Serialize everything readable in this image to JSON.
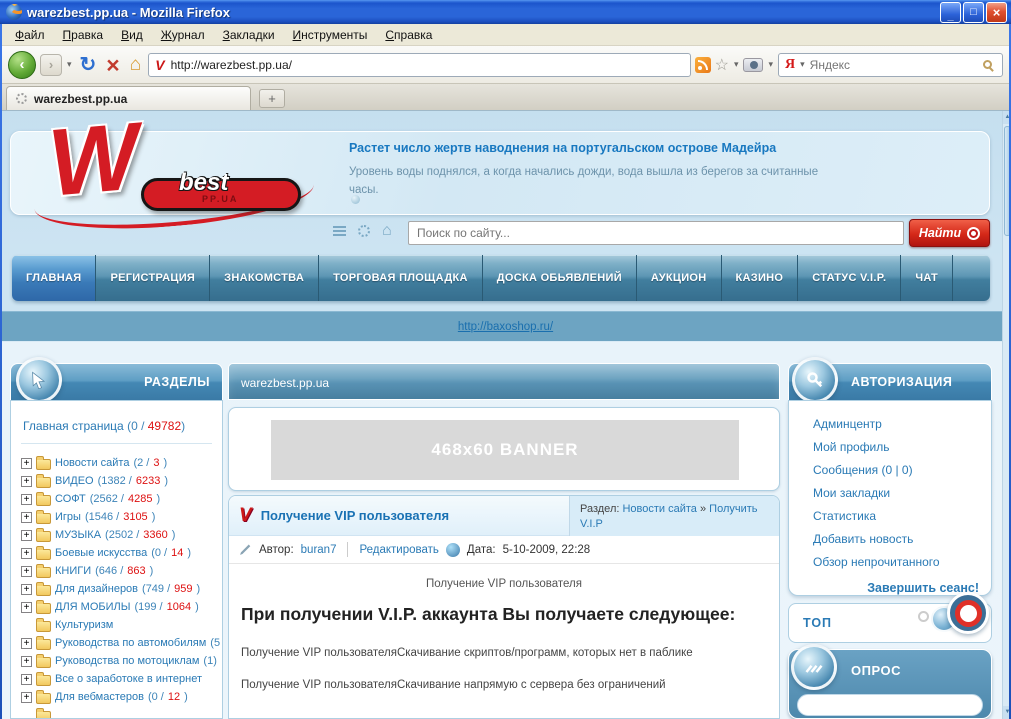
{
  "window": {
    "title": "warezbest.pp.ua - Mozilla Firefox",
    "menu_items": [
      "Файл",
      "Правка",
      "Вид",
      "Журнал",
      "Закладки",
      "Инструменты",
      "Справка"
    ],
    "url": "http://warezbest.pp.ua/",
    "yandex_placeholder": "Яндекс",
    "tab_title": "warezbest.pp.ua",
    "new_tab_label": "+"
  },
  "site_header": {
    "logo": {
      "letter": "W",
      "best": "best",
      "domain": "PP.UA"
    },
    "news_title": "Растет число жертв наводнения на португальском острове Мадейра",
    "news_body": "Уровень воды поднялся, а когда начались дожди, вода вышла из берегов за считанные часы."
  },
  "search": {
    "placeholder": "Поиск по сайту...",
    "button_label": "Найти"
  },
  "nav": {
    "items": [
      {
        "label": "ГЛАВНАЯ",
        "active": true
      },
      {
        "label": "РЕГИСТРАЦИЯ",
        "active": false
      },
      {
        "label": "ЗНАКОМСТВА",
        "active": false
      },
      {
        "label": "ТОРГОВАЯ ПЛОЩАДКА",
        "active": false
      },
      {
        "label": "ДОСКА ОБЬЯВЛЕНИЙ",
        "active": false
      },
      {
        "label": "АУКЦИОН",
        "active": false
      },
      {
        "label": "КАЗИНО",
        "active": false
      },
      {
        "label": "СТАТУС V.I.P.",
        "active": false
      },
      {
        "label": "ЧАТ",
        "active": false
      }
    ]
  },
  "banner_strip": {
    "link": "http://baxoshop.ru/"
  },
  "sections_panel": {
    "title": "РАЗДЕЛЫ",
    "home": {
      "label": "Главная страница",
      "count_open": " (0 / ",
      "count_red": "49782",
      "count_close": ")"
    },
    "items": [
      {
        "plus": true,
        "label": "Новости сайта",
        "c1": "(2 / ",
        "c2": "3",
        "c3": ")"
      },
      {
        "plus": true,
        "label": "ВИДЕО",
        "c1": "(1382 / ",
        "c2": "6233",
        "c3": ")"
      },
      {
        "plus": true,
        "label": "СОФТ",
        "c1": "(2562 / ",
        "c2": "4285",
        "c3": ")"
      },
      {
        "plus": true,
        "label": "Игры",
        "c1": "(1546 / ",
        "c2": "3105",
        "c3": ")"
      },
      {
        "plus": true,
        "label": "МУЗЫКА",
        "c1": "(2502 / ",
        "c2": "3360",
        "c3": ")"
      },
      {
        "plus": true,
        "label": "Боевые искусства",
        "c1": "(0 / ",
        "c2": "14",
        "c3": ")"
      },
      {
        "plus": true,
        "label": "КНИГИ",
        "c1": "(646 / ",
        "c2": "863",
        "c3": ")"
      },
      {
        "plus": true,
        "label": "Для дизайнеров",
        "c1": "(749 / ",
        "c2": "959",
        "c3": ")"
      },
      {
        "plus": true,
        "label": "ДЛЯ МОБИЛЫ",
        "c1": "(199 / ",
        "c2": "1064",
        "c3": ")"
      },
      {
        "plus": false,
        "label": "Культуризм",
        "c1": "",
        "c2": "",
        "c3": ""
      },
      {
        "plus": true,
        "label": "Руководства по автомобилям",
        "c1": "(5",
        "c2": "",
        "c3": ""
      },
      {
        "plus": true,
        "label": "Руководства по мотоциклам",
        "c1": "(1)",
        "c2": "",
        "c3": ""
      },
      {
        "plus": true,
        "label": "Все о заработоке в интернет",
        "c1": "",
        "c2": "",
        "c3": ""
      },
      {
        "plus": true,
        "label": "Для вебмастеров",
        "c1": "(0 / ",
        "c2": "12",
        "c3": ")"
      },
      {
        "plus": false,
        "label": "",
        "c1": "",
        "c2": "",
        "c3": ""
      }
    ]
  },
  "main": {
    "bar_title": "warezbest.pp.ua",
    "banner_text": "468x60 BANNER",
    "article": {
      "title": "Получение VIP пользователя",
      "breadcrumb_label": "Раздел:",
      "breadcrumb_link1": "Новости сайта",
      "breadcrumb_sep": "»",
      "breadcrumb_link2": "Получить V.I.P",
      "author_label": "Автор:",
      "author": "buran7",
      "edit_link": "Редактировать",
      "date_label": "Дата:",
      "date": "5-10-2009, 22:28",
      "line1": "Получение VIP пользователя",
      "heading": "При получении V.I.P. аккаунта Вы получаете следующее:",
      "para1": "Получение VIP пользователяСкачивание скриптов/программ, которых нет в паблике",
      "para2": "Получение VIP пользователяСкачивание напрямую с сервера без ограничений"
    }
  },
  "auth_panel": {
    "title": "АВТОРИЗАЦИЯ",
    "links": [
      "Админцентр",
      "Мой профиль",
      "Сообщения (0 | 0)",
      "Мои закладки",
      "Статистика",
      "Добавить новость",
      "Обзор непрочитанного"
    ],
    "logout": "Завершить сеанс!"
  },
  "top_panel": {
    "title": "ТОП"
  },
  "poll_panel": {
    "title": "ОПРОС"
  },
  "colors": {
    "accent_red": "#dd1111",
    "link_blue": "#2a7ab5",
    "nav_steel": "#417e9e"
  }
}
